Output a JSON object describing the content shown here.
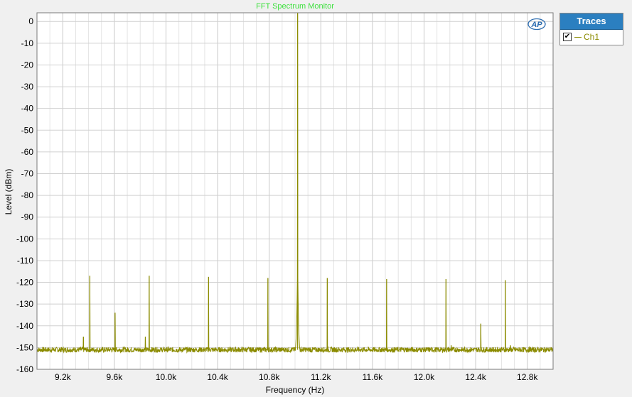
{
  "chart_data": {
    "type": "line",
    "title": "FFT Spectrum Monitor",
    "xlabel": "Frequency (Hz)",
    "ylabel": "Level (dBm)",
    "xlim": [
      9000,
      13000
    ],
    "ylim": [
      -160,
      4
    ],
    "x_ticks": [
      9200,
      9600,
      10000,
      10400,
      10800,
      11200,
      11600,
      12000,
      12400,
      12800
    ],
    "x_tick_labels": [
      "9.2k",
      "9.6k",
      "10.0k",
      "10.4k",
      "10.8k",
      "11.2k",
      "11.6k",
      "12.0k",
      "12.4k",
      "12.8k"
    ],
    "y_ticks": [
      0,
      -10,
      -20,
      -30,
      -40,
      -50,
      -60,
      -70,
      -80,
      -90,
      -100,
      -110,
      -120,
      -130,
      -140,
      -150,
      -160
    ],
    "y_tick_labels": [
      "0",
      "-10",
      "-20",
      "-30",
      "-40",
      "-50",
      "-60",
      "-70",
      "-80",
      "-90",
      "-100",
      "-110",
      "-120",
      "-130",
      "-140",
      "-150",
      "-160"
    ],
    "grid": true,
    "legend_placement": "top-right",
    "noise_floor_dbm": -151,
    "series": [
      {
        "name": "Ch1",
        "color": "#8b8b00",
        "peaks": [
          {
            "x": 9360,
            "y": -145
          },
          {
            "x": 9410,
            "y": -117
          },
          {
            "x": 9605,
            "y": -134
          },
          {
            "x": 9840,
            "y": -145
          },
          {
            "x": 9870,
            "y": -117
          },
          {
            "x": 10330,
            "y": -117.5
          },
          {
            "x": 10790,
            "y": -118
          },
          {
            "x": 11020,
            "y": 4
          },
          {
            "x": 11250,
            "y": -118
          },
          {
            "x": 11710,
            "y": -118.5
          },
          {
            "x": 12170,
            "y": -118.5
          },
          {
            "x": 12210,
            "y": -149
          },
          {
            "x": 12440,
            "y": -139
          },
          {
            "x": 12630,
            "y": -119
          },
          {
            "x": 12670,
            "y": -149
          }
        ]
      }
    ]
  },
  "legend": {
    "header": "Traces",
    "items": [
      {
        "label": "Ch1",
        "checked": true,
        "check_mark": "✔"
      }
    ]
  },
  "logo_text": "AP"
}
